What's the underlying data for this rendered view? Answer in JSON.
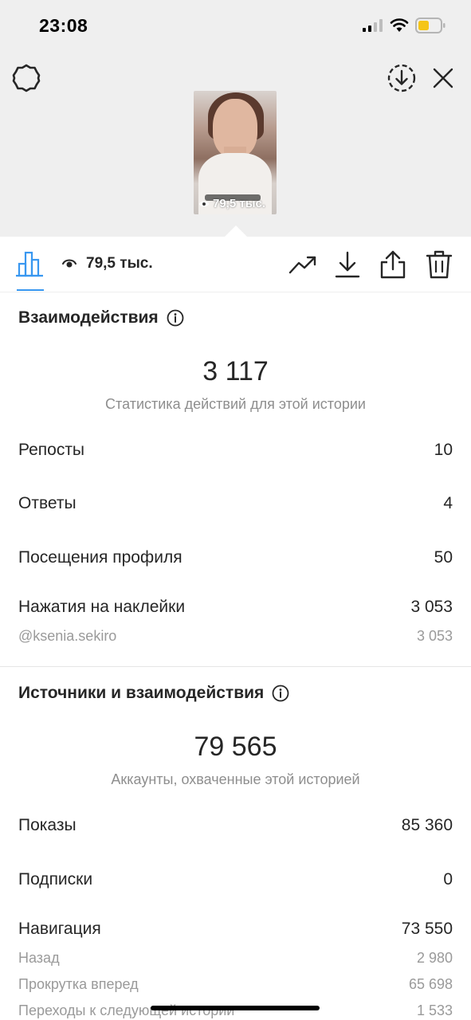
{
  "status_bar": {
    "time": "23:08"
  },
  "story": {
    "views_overlay": "79,5 тыс."
  },
  "toolbar": {
    "views": "79,5 тыс."
  },
  "interactions": {
    "title": "Взаимодействия",
    "total": "3 117",
    "caption": "Статистика действий для этой истории",
    "rows": [
      {
        "label": "Репосты",
        "value": "10"
      },
      {
        "label": "Ответы",
        "value": "4"
      },
      {
        "label": "Посещения профиля",
        "value": "50"
      },
      {
        "label": "Нажатия на наклейки",
        "value": "3 053"
      }
    ],
    "sub_rows": [
      {
        "label": "@ksenia.sekiro",
        "value": "3 053"
      }
    ]
  },
  "discovery": {
    "title": "Источники и взаимодействия",
    "total": "79 565",
    "caption": "Аккаунты, охваченные этой историей",
    "rows": [
      {
        "label": "Показы",
        "value": "85 360"
      },
      {
        "label": "Подписки",
        "value": "0"
      },
      {
        "label": "Навигация",
        "value": "73 550"
      }
    ],
    "sub_rows": [
      {
        "label": "Назад",
        "value": "2 980"
      },
      {
        "label": "Прокрутка вперед",
        "value": "65 698"
      },
      {
        "label": "Переходы к следующей истории",
        "value": "1 533"
      }
    ]
  },
  "colors": {
    "accent": "#3897f0",
    "text": "#262626",
    "muted": "#8e8e8e",
    "battery": "#f5c518"
  }
}
